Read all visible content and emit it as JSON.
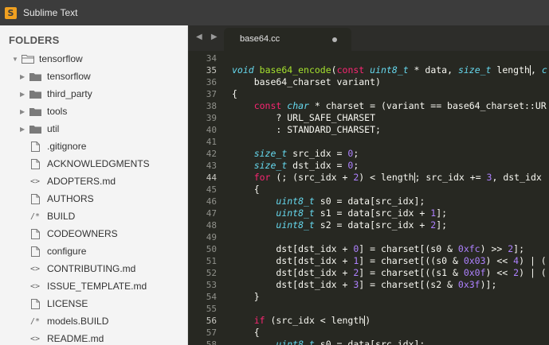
{
  "window": {
    "title": "Sublime Text"
  },
  "sidebar": {
    "header": "FOLDERS",
    "root": "tensorflow",
    "items": [
      {
        "label": "tensorflow",
        "kind": "folder"
      },
      {
        "label": "third_party",
        "kind": "folder"
      },
      {
        "label": "tools",
        "kind": "folder"
      },
      {
        "label": "util",
        "kind": "folder"
      },
      {
        "label": ".gitignore",
        "kind": "file",
        "icon": ""
      },
      {
        "label": "ACKNOWLEDGMENTS",
        "kind": "file",
        "icon": ""
      },
      {
        "label": "ADOPTERS.md",
        "kind": "file",
        "icon": "<>"
      },
      {
        "label": "AUTHORS",
        "kind": "file",
        "icon": ""
      },
      {
        "label": "BUILD",
        "kind": "file",
        "icon": "/*"
      },
      {
        "label": "CODEOWNERS",
        "kind": "file",
        "icon": ""
      },
      {
        "label": "configure",
        "kind": "file",
        "icon": ""
      },
      {
        "label": "CONTRIBUTING.md",
        "kind": "file",
        "icon": "<>"
      },
      {
        "label": "ISSUE_TEMPLATE.md",
        "kind": "file",
        "icon": "<>"
      },
      {
        "label": "LICENSE",
        "kind": "file",
        "icon": ""
      },
      {
        "label": "models.BUILD",
        "kind": "file",
        "icon": "/*"
      },
      {
        "label": "README.md",
        "kind": "file",
        "icon": "<>"
      }
    ]
  },
  "editor": {
    "tab": {
      "label": "base64.cc",
      "modified": true
    },
    "active_lines": [
      35,
      44,
      56
    ],
    "lines": [
      {
        "n": "34",
        "t": []
      },
      {
        "n": "35",
        "t": [
          [
            "ty",
            "void"
          ],
          [
            "p",
            " "
          ],
          [
            "fn",
            "base64_encode"
          ],
          [
            "p",
            "("
          ],
          [
            "kw",
            "const"
          ],
          [
            "p",
            " "
          ],
          [
            "ty",
            "uint8_t"
          ],
          [
            "p",
            " * data, "
          ],
          [
            "ty",
            "size_t"
          ],
          [
            "p",
            " length"
          ],
          [
            "cur",
            ""
          ],
          [
            "p",
            ", "
          ],
          [
            "ty",
            "c"
          ]
        ]
      },
      {
        "n": "36",
        "t": [
          [
            "p",
            "    base64_charset variant)"
          ]
        ]
      },
      {
        "n": "37",
        "t": [
          [
            "p",
            "{"
          ]
        ]
      },
      {
        "n": "38",
        "t": [
          [
            "p",
            "    "
          ],
          [
            "kw",
            "const"
          ],
          [
            "p",
            " "
          ],
          [
            "ty",
            "char"
          ],
          [
            "p",
            " * charset = (variant == base64_charset::UR"
          ]
        ]
      },
      {
        "n": "39",
        "t": [
          [
            "p",
            "        ? URL_SAFE_CHARSET"
          ]
        ]
      },
      {
        "n": "40",
        "t": [
          [
            "p",
            "        : STANDARD_CHARSET;"
          ]
        ]
      },
      {
        "n": "41",
        "t": []
      },
      {
        "n": "42",
        "t": [
          [
            "p",
            "    "
          ],
          [
            "ty",
            "size_t"
          ],
          [
            "p",
            " src_idx = "
          ],
          [
            "nm",
            "0"
          ],
          [
            "p",
            ";"
          ]
        ]
      },
      {
        "n": "43",
        "t": [
          [
            "p",
            "    "
          ],
          [
            "ty",
            "size_t"
          ],
          [
            "p",
            " dst_idx = "
          ],
          [
            "nm",
            "0"
          ],
          [
            "p",
            ";"
          ]
        ]
      },
      {
        "n": "44",
        "t": [
          [
            "p",
            "    "
          ],
          [
            "kw",
            "for"
          ],
          [
            "p",
            " (; (src_idx + "
          ],
          [
            "nm",
            "2"
          ],
          [
            "p",
            ") < length"
          ],
          [
            "cur",
            ""
          ],
          [
            "p",
            "; src_idx += "
          ],
          [
            "nm",
            "3"
          ],
          [
            "p",
            ", dst_idx "
          ]
        ]
      },
      {
        "n": "45",
        "t": [
          [
            "p",
            "    {"
          ]
        ]
      },
      {
        "n": "46",
        "t": [
          [
            "p",
            "        "
          ],
          [
            "ty",
            "uint8_t"
          ],
          [
            "p",
            " s0 = data[src_idx];"
          ]
        ]
      },
      {
        "n": "47",
        "t": [
          [
            "p",
            "        "
          ],
          [
            "ty",
            "uint8_t"
          ],
          [
            "p",
            " s1 = data[src_idx + "
          ],
          [
            "nm",
            "1"
          ],
          [
            "p",
            "];"
          ]
        ]
      },
      {
        "n": "48",
        "t": [
          [
            "p",
            "        "
          ],
          [
            "ty",
            "uint8_t"
          ],
          [
            "p",
            " s2 = data[src_idx + "
          ],
          [
            "nm",
            "2"
          ],
          [
            "p",
            "];"
          ]
        ]
      },
      {
        "n": "49",
        "t": []
      },
      {
        "n": "50",
        "t": [
          [
            "p",
            "        dst[dst_idx + "
          ],
          [
            "nm",
            "0"
          ],
          [
            "p",
            "] = charset[(s0 & "
          ],
          [
            "nm",
            "0xfc"
          ],
          [
            "p",
            ") >> "
          ],
          [
            "nm",
            "2"
          ],
          [
            "p",
            "];"
          ]
        ]
      },
      {
        "n": "51",
        "t": [
          [
            "p",
            "        dst[dst_idx + "
          ],
          [
            "nm",
            "1"
          ],
          [
            "p",
            "] = charset[((s0 & "
          ],
          [
            "nm",
            "0x03"
          ],
          [
            "p",
            ") << "
          ],
          [
            "nm",
            "4"
          ],
          [
            "p",
            ") | ("
          ]
        ]
      },
      {
        "n": "52",
        "t": [
          [
            "p",
            "        dst[dst_idx + "
          ],
          [
            "nm",
            "2"
          ],
          [
            "p",
            "] = charset[((s1 & "
          ],
          [
            "nm",
            "0x0f"
          ],
          [
            "p",
            ") << "
          ],
          [
            "nm",
            "2"
          ],
          [
            "p",
            ") | ("
          ]
        ]
      },
      {
        "n": "53",
        "t": [
          [
            "p",
            "        dst[dst_idx + "
          ],
          [
            "nm",
            "3"
          ],
          [
            "p",
            "] = charset[(s2 & "
          ],
          [
            "nm",
            "0x3f"
          ],
          [
            "p",
            ")];"
          ]
        ]
      },
      {
        "n": "54",
        "t": [
          [
            "p",
            "    }"
          ]
        ]
      },
      {
        "n": "55",
        "t": []
      },
      {
        "n": "56",
        "t": [
          [
            "p",
            "    "
          ],
          [
            "kw",
            "if"
          ],
          [
            "p",
            " (src_idx < length"
          ],
          [
            "cur",
            ""
          ],
          [
            "p",
            ")"
          ]
        ]
      },
      {
        "n": "57",
        "t": [
          [
            "p",
            "    {"
          ]
        ]
      },
      {
        "n": "58",
        "t": [
          [
            "p",
            "        "
          ],
          [
            "ty",
            "uint8_t"
          ],
          [
            "p",
            " s0 = data[src_idx];"
          ]
        ]
      }
    ]
  }
}
